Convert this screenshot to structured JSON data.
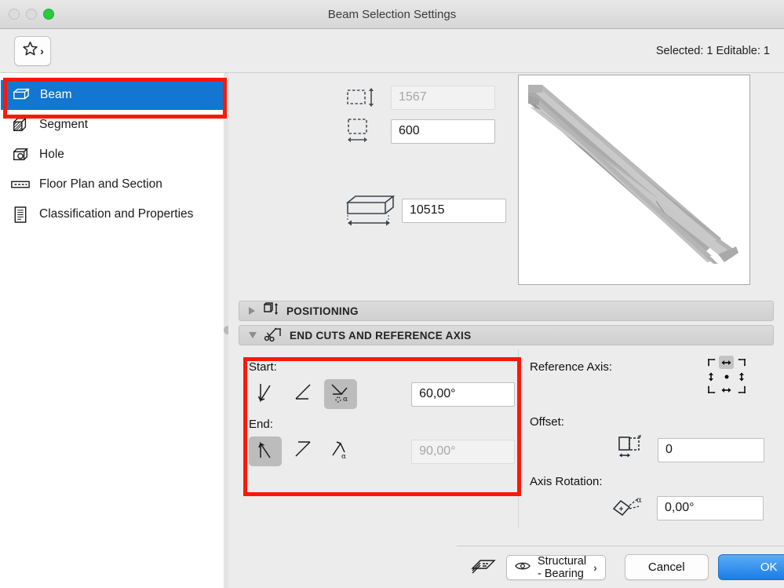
{
  "window": {
    "title": "Beam Selection Settings",
    "traffic_lights": [
      "close-button",
      "minimize-button",
      "zoom-button"
    ]
  },
  "toolbar": {
    "favorites_icon": "star-icon",
    "favorites_chevron": "›",
    "selection_info": "Selected: 1 Editable: 1"
  },
  "sidebar": {
    "items": [
      {
        "label": "Beam",
        "icon": "beam-icon",
        "selected": true
      },
      {
        "label": "Segment",
        "icon": "segment-icon",
        "selected": false
      },
      {
        "label": "Hole",
        "icon": "hole-icon",
        "selected": false
      },
      {
        "label": "Floor Plan and Section",
        "icon": "floor-plan-icon",
        "selected": false
      },
      {
        "label": "Classification and Properties",
        "icon": "classification-icon",
        "selected": false
      }
    ]
  },
  "dimensions": {
    "height": {
      "icon": "height-dimension-icon",
      "value": "1567",
      "disabled": true
    },
    "width": {
      "icon": "width-dimension-icon",
      "value": "600",
      "disabled": false
    },
    "length": {
      "icon": "length-dimension-icon",
      "value": "10515",
      "disabled": false
    }
  },
  "preview": {
    "name": "beam-3d-preview"
  },
  "sections": [
    {
      "id": "positioning",
      "label": "POSITIONING",
      "expanded": false,
      "icon": "positioning-icon"
    },
    {
      "id": "end-cuts",
      "label": "END CUTS AND REFERENCE AXIS",
      "expanded": true,
      "icon": "scissors-icon"
    }
  ],
  "end_cuts": {
    "start": {
      "label": "Start:",
      "options": [
        {
          "icon": "cut-vertical-icon",
          "selected": false
        },
        {
          "icon": "cut-slanted-icon",
          "selected": false
        },
        {
          "icon": "cut-angle-alpha-icon",
          "selected": true
        }
      ],
      "angle": "60,00°",
      "angle_disabled": false
    },
    "end": {
      "label": "End:",
      "options": [
        {
          "icon": "cut-vertical-icon",
          "selected": true
        },
        {
          "icon": "cut-slanted-icon",
          "selected": false
        },
        {
          "icon": "cut-angle-alpha-icon",
          "selected": false
        }
      ],
      "angle": "90,00°",
      "angle_disabled": true
    }
  },
  "reference_axis": {
    "label": "Reference Axis:",
    "anchor_selected": "top-center",
    "offset": {
      "label": "Offset:",
      "icon": "offset-icon",
      "value": "0"
    },
    "axis_rotation": {
      "label": "Axis Rotation:",
      "icon": "axis-rotation-icon",
      "value": "0,00°"
    }
  },
  "bottom_bar": {
    "layers_icon": "layers-stack-icon",
    "layer_eye_icon": "eye-icon",
    "layer_name": "Structural - Bearing",
    "layer_chevron": "›",
    "cancel_label": "Cancel",
    "ok_label": "OK"
  },
  "colors": {
    "selection_blue": "#1276D2",
    "ok_button_blue": "#1A7DE7",
    "annotation_red": "#FC1808",
    "window_bg": "#ECECEC"
  }
}
